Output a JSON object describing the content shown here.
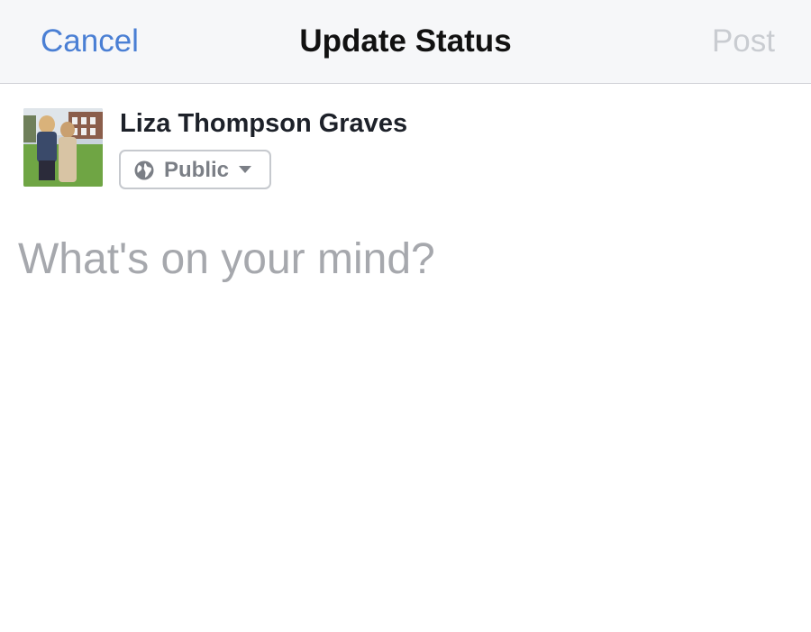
{
  "navbar": {
    "cancel_label": "Cancel",
    "title": "Update Status",
    "post_label": "Post"
  },
  "user": {
    "name": "Liza Thompson Graves",
    "avatar_icon": "profile-photo"
  },
  "privacy": {
    "selected": "Public",
    "icon": "globe-icon"
  },
  "composer": {
    "placeholder": "What's on your mind?",
    "value": ""
  },
  "colors": {
    "link_blue": "#4a7fd4",
    "disabled_gray": "#c9ccd1",
    "navbar_bg": "#f6f7f9",
    "placeholder_gray": "#a6a8ad"
  }
}
